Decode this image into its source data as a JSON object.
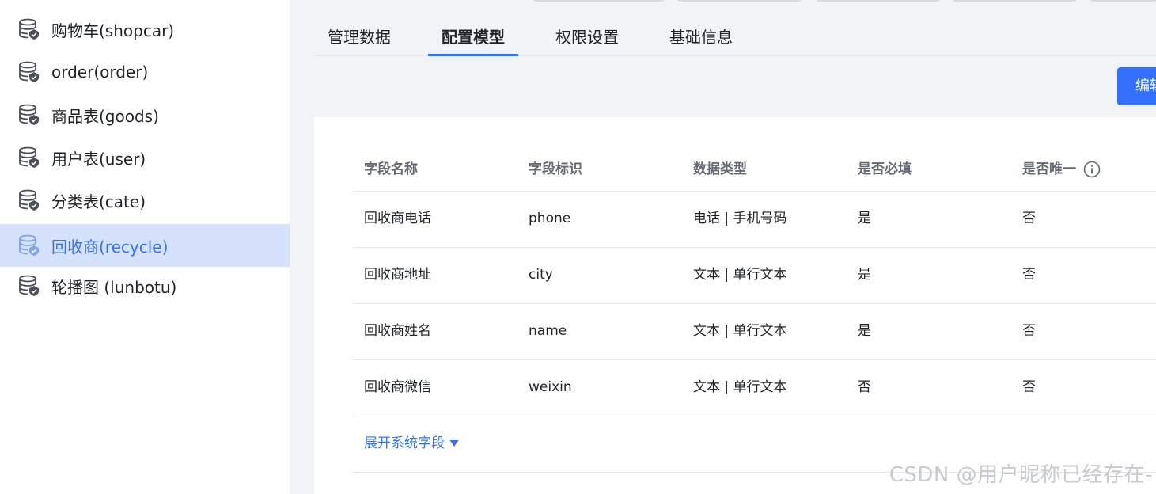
{
  "sidebar": {
    "items": [
      {
        "label": "购物车(shopcar)",
        "icon": "database-icon"
      },
      {
        "label": "order(order)",
        "icon": "database-icon"
      },
      {
        "label": "商品表(goods)",
        "icon": "database-icon"
      },
      {
        "label": "用户表(user)",
        "icon": "database-icon"
      },
      {
        "label": "分类表(cate)",
        "icon": "database-icon"
      },
      {
        "label": "回收商(recycle)",
        "icon": "database-icon",
        "active": true
      },
      {
        "label": "轮播图 (lunbotu)",
        "icon": "database-icon"
      }
    ]
  },
  "tabs": [
    {
      "label": "管理数据"
    },
    {
      "label": "配置模型",
      "active": true
    },
    {
      "label": "权限设置"
    },
    {
      "label": "基础信息"
    }
  ],
  "toolbar": {
    "edit_label": "编辑"
  },
  "table": {
    "headers": [
      "字段名称",
      "字段标识",
      "数据类型",
      "是否必填",
      "是否唯一"
    ],
    "rows": [
      [
        "回收商电话",
        "phone",
        "电话 | 手机号码",
        "是",
        "否"
      ],
      [
        "回收商地址",
        "city",
        "文本 | 单行文本",
        "是",
        "否"
      ],
      [
        "回收商姓名",
        "name",
        "文本 | 单行文本",
        "是",
        "否"
      ],
      [
        "回收商微信",
        "weixin",
        "文本 | 单行文本",
        "否",
        "否"
      ]
    ],
    "expand_label": "展开系统字段"
  },
  "watermark": "CSDN @用户昵称已经存在-",
  "colors": {
    "accent": "#3370ff",
    "active_bg": "#d6e2fb",
    "page_bg": "#f2f3f7"
  }
}
